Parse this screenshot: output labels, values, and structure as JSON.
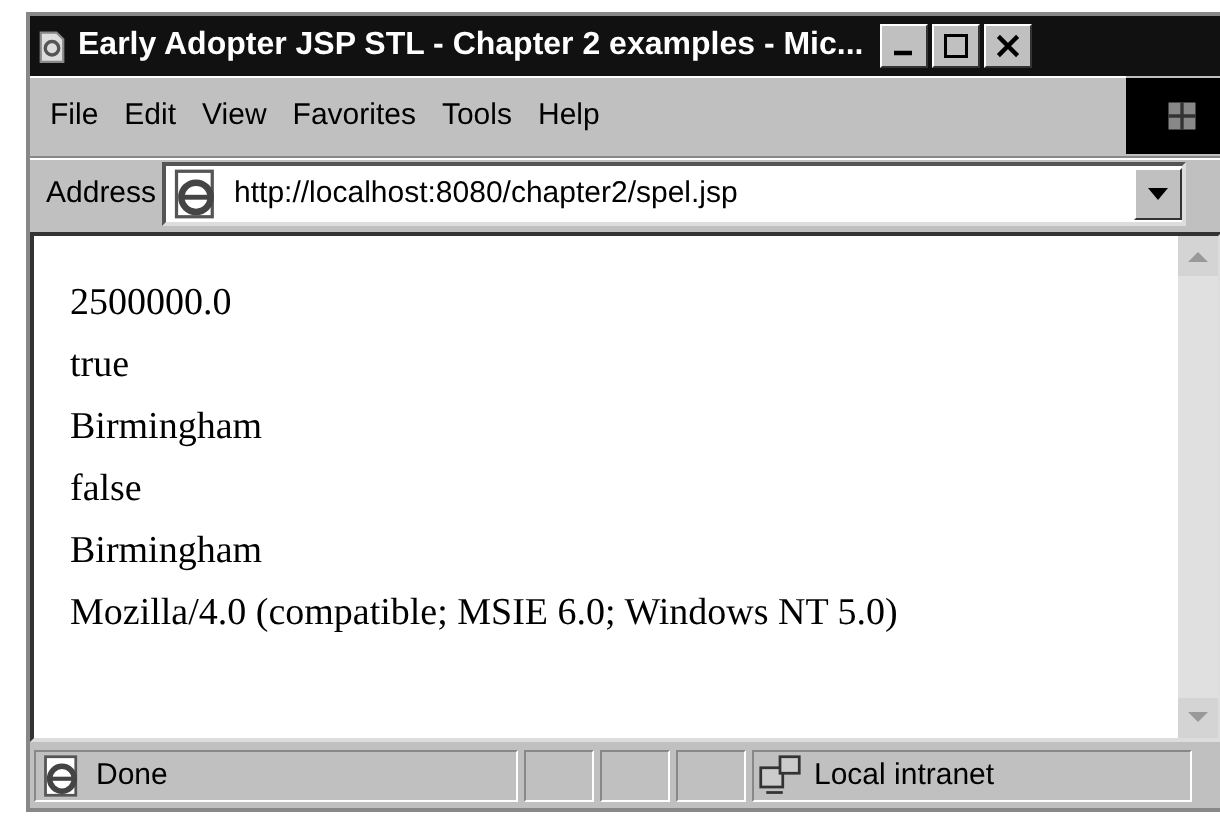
{
  "window": {
    "title": "Early Adopter JSP STL - Chapter 2 examples - Mic..."
  },
  "menu": [
    "File",
    "Edit",
    "View",
    "Favorites",
    "Tools",
    "Help"
  ],
  "address_bar": {
    "label": "Address",
    "value": "http://localhost:8080/chapter2/spel.jsp"
  },
  "content": {
    "lines": [
      "2500000.0",
      "true",
      "Birmingham",
      "false",
      "Birmingham",
      "Mozilla/4.0 (compatible; MSIE 6.0; Windows NT 5.0)"
    ]
  },
  "status_bar": {
    "status": "Done",
    "zone": "Local intranet"
  }
}
